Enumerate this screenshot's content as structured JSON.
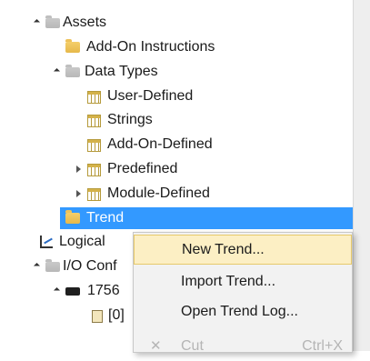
{
  "tree": {
    "assets": "Assets",
    "add_on_instructions": "Add-On Instructions",
    "data_types": "Data Types",
    "user_defined": "User-Defined",
    "strings": "Strings",
    "add_on_defined": "Add-On-Defined",
    "predefined": "Predefined",
    "module_defined": "Module-Defined",
    "trends": "Trend",
    "logical_model": "Logical",
    "io_config": "I/O Conf",
    "chassis": "1756",
    "slot0": "[0]"
  },
  "context_menu": {
    "new_trend": "New Trend...",
    "import_trend": "Import Trend...",
    "open_trend_log": "Open Trend Log...",
    "cut": "Cut",
    "cut_shortcut": "Ctrl+X"
  },
  "colors": {
    "selection": "#3399ff",
    "menu_hover": "#fcefc4",
    "menu_background": "#f2f2f2"
  },
  "icons": {
    "assets": "folder-open-icon",
    "add_on_instructions": "folder-icon",
    "data_types": "folder-open-icon",
    "user_defined": "data-grid-icon",
    "trends": "folder-icon",
    "logical_model": "trend-chart-icon",
    "chassis": "module-icon"
  }
}
